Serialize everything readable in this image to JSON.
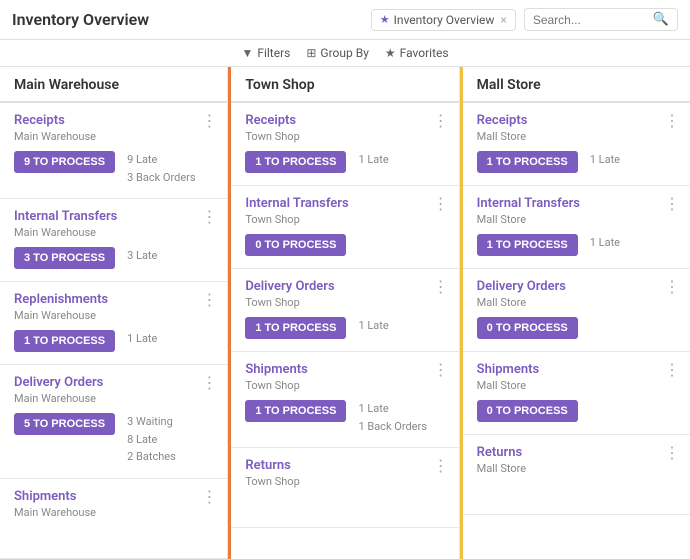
{
  "header": {
    "title": "Inventory Overview",
    "tab": {
      "label": "Inventory Overview",
      "star": "★",
      "close": "×"
    },
    "search_placeholder": "Search..."
  },
  "toolbar": {
    "filters_label": "Filters",
    "group_by_label": "Group By",
    "favorites_label": "Favorites"
  },
  "columns": [
    {
      "id": "main-warehouse",
      "header": "Main Warehouse",
      "accent": "none",
      "cards": [
        {
          "title": "Receipts",
          "subtitle": "Main Warehouse",
          "btn_label": "9 TO PROCESS",
          "btn_style": "filled",
          "stats": [
            "9 Late",
            "3 Back Orders"
          ]
        },
        {
          "title": "Internal Transfers",
          "subtitle": "Main Warehouse",
          "btn_label": "3 TO PROCESS",
          "btn_style": "filled",
          "stats": [
            "3 Late"
          ]
        },
        {
          "title": "Replenishments",
          "subtitle": "Main Warehouse",
          "btn_label": "1 TO PROCESS",
          "btn_style": "filled",
          "stats": [
            "1 Late"
          ]
        },
        {
          "title": "Delivery Orders",
          "subtitle": "Main Warehouse",
          "btn_label": "5 TO PROCESS",
          "btn_style": "filled",
          "stats": [
            "3 Waiting",
            "8 Late",
            "2 Batches"
          ]
        },
        {
          "title": "Shipments",
          "subtitle": "Main Warehouse",
          "btn_label": "",
          "btn_style": "none",
          "stats": []
        }
      ]
    },
    {
      "id": "town-shop",
      "header": "Town Shop",
      "accent": "orange",
      "cards": [
        {
          "title": "Receipts",
          "subtitle": "Town Shop",
          "btn_label": "1 TO PROCESS",
          "btn_style": "filled",
          "stats": [
            "1 Late"
          ]
        },
        {
          "title": "Internal Transfers",
          "subtitle": "Town Shop",
          "btn_label": "0 TO PROCESS",
          "btn_style": "filled",
          "stats": []
        },
        {
          "title": "Delivery Orders",
          "subtitle": "Town Shop",
          "btn_label": "1 TO PROCESS",
          "btn_style": "filled",
          "stats": [
            "1 Late"
          ]
        },
        {
          "title": "Shipments",
          "subtitle": "Town Shop",
          "btn_label": "1 TO PROCESS",
          "btn_style": "filled",
          "stats": [
            "1 Late",
            "1 Back Orders"
          ]
        },
        {
          "title": "Returns",
          "subtitle": "Town Shop",
          "btn_label": "",
          "btn_style": "none",
          "stats": []
        }
      ]
    },
    {
      "id": "mall-store",
      "header": "Mall Store",
      "accent": "yellow",
      "cards": [
        {
          "title": "Receipts",
          "subtitle": "Mall Store",
          "btn_label": "1 TO PROCESS",
          "btn_style": "filled",
          "stats": [
            "1 Late"
          ]
        },
        {
          "title": "Internal Transfers",
          "subtitle": "Mall Store",
          "btn_label": "1 TO PROCESS",
          "btn_style": "filled",
          "stats": [
            "1 Late"
          ]
        },
        {
          "title": "Delivery Orders",
          "subtitle": "Mall Store",
          "btn_label": "0 TO PROCESS",
          "btn_style": "filled",
          "stats": []
        },
        {
          "title": "Shipments",
          "subtitle": "Mall Store",
          "btn_label": "0 TO PROCESS",
          "btn_style": "filled",
          "stats": []
        },
        {
          "title": "Returns",
          "subtitle": "Mall Store",
          "btn_label": "",
          "btn_style": "none",
          "stats": []
        }
      ]
    }
  ]
}
